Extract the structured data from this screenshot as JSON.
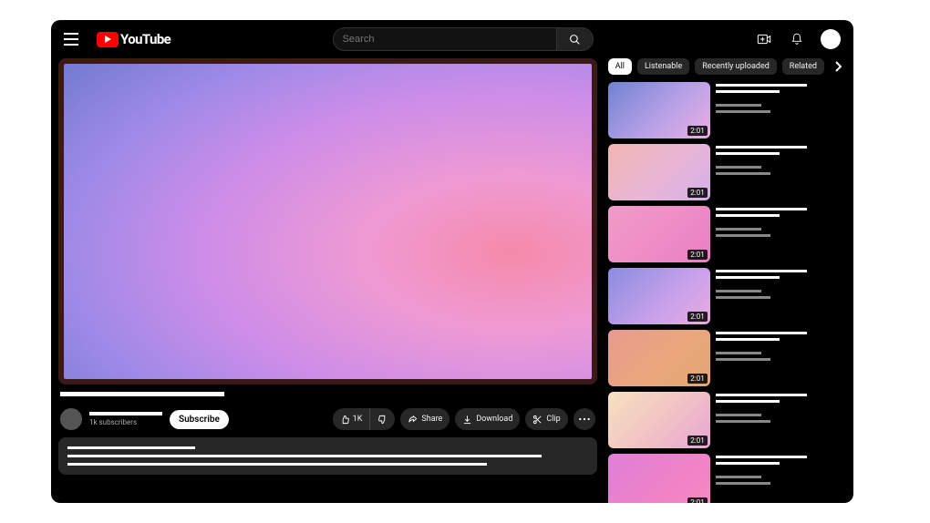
{
  "header": {
    "logo_text": "YouTube",
    "search_placeholder": "Search"
  },
  "video": {
    "channel_subs": "1k subscribers",
    "subscribe_label": "Subscribe"
  },
  "actions": {
    "like_count": "1K",
    "share": "Share",
    "download": "Download",
    "clip": "Clip"
  },
  "chips": [
    "All",
    "Listenable",
    "Recently uploaded",
    "Related"
  ],
  "chip_active": "All",
  "related": [
    {
      "duration": "2:01",
      "gradient": "g1"
    },
    {
      "duration": "2:01",
      "gradient": "g2"
    },
    {
      "duration": "2:01",
      "gradient": "g3"
    },
    {
      "duration": "2:01",
      "gradient": "g4"
    },
    {
      "duration": "2:01",
      "gradient": "g5"
    },
    {
      "duration": "2:01",
      "gradient": "g6"
    },
    {
      "duration": "2:01",
      "gradient": "g7"
    }
  ]
}
